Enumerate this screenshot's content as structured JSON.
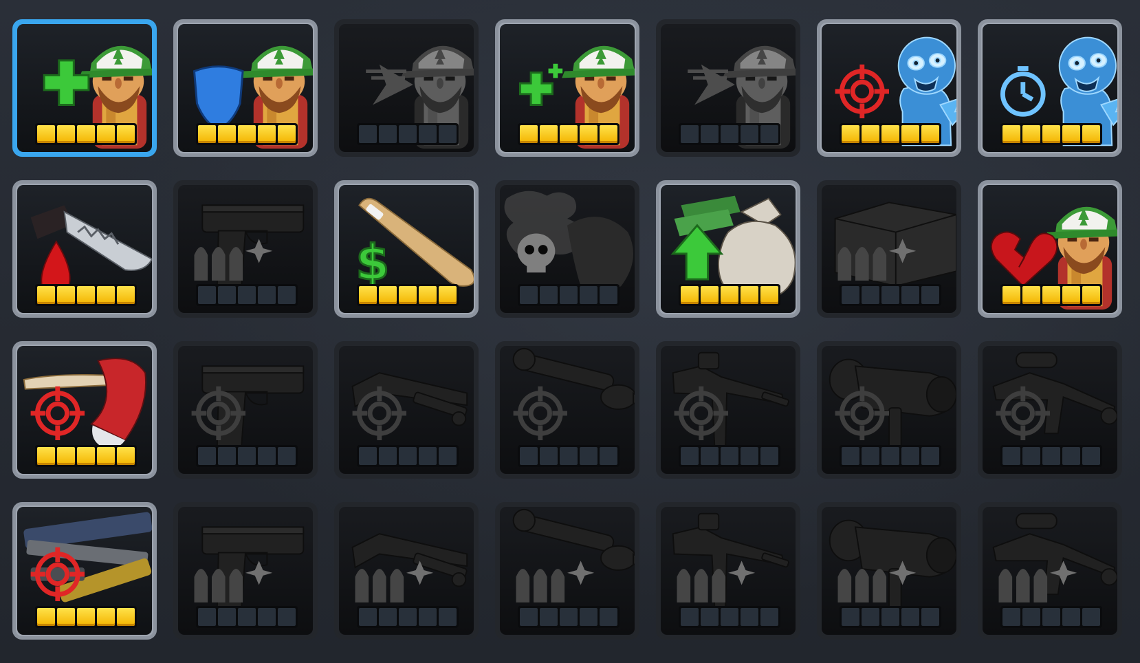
{
  "upgrades": [
    {
      "id": "hero-health",
      "icon": "green-plus-icon",
      "subject": "hero-portrait",
      "level": 5,
      "max": 5,
      "state": "selected"
    },
    {
      "id": "hero-armor",
      "icon": "blue-shield-icon",
      "subject": "hero-portrait",
      "level": 5,
      "max": 5,
      "state": "unlocked"
    },
    {
      "id": "hero-speed",
      "icon": "speed-arrow-icon",
      "subject": "hero-portrait",
      "level": 0,
      "max": 5,
      "state": "locked"
    },
    {
      "id": "hero-regen",
      "icon": "small-green-plus-icon",
      "subject": "hero-portrait",
      "level": 5,
      "max": 5,
      "state": "unlocked"
    },
    {
      "id": "hero-dash",
      "icon": "speed-arrow-icon",
      "subject": "hero-portrait",
      "level": 0,
      "max": 5,
      "state": "locked"
    },
    {
      "id": "zombie-damage",
      "icon": "red-crosshair-icon",
      "subject": "ice-zombie",
      "level": 5,
      "max": 5,
      "state": "unlocked"
    },
    {
      "id": "zombie-freeze-time",
      "icon": "stopwatch-icon",
      "subject": "ice-zombie",
      "level": 5,
      "max": 5,
      "state": "unlocked"
    },
    {
      "id": "knife-bleed",
      "icon": "blood-drop-icon",
      "subject": "knife",
      "level": 5,
      "max": 5,
      "state": "unlocked"
    },
    {
      "id": "pistol-ammo",
      "icon": "bullets-icon",
      "subject": "pistol",
      "level": 0,
      "max": 5,
      "state": "locked"
    },
    {
      "id": "bat-cash",
      "icon": "dollar-icon",
      "subject": "baseball-bat",
      "level": 5,
      "max": 5,
      "state": "unlocked"
    },
    {
      "id": "poison-cloud",
      "icon": "skull-icon",
      "subject": "poison-cloud",
      "level": 0,
      "max": 5,
      "state": "locked"
    },
    {
      "id": "money-bonus",
      "icon": "green-up-arrow-icon",
      "subject": "money-bag",
      "level": 5,
      "max": 5,
      "state": "unlocked"
    },
    {
      "id": "crate-ammo",
      "icon": "bullets-icon",
      "subject": "ammo-crate",
      "level": 0,
      "max": 5,
      "state": "locked"
    },
    {
      "id": "hero-revive",
      "icon": "broken-heart-icon",
      "subject": "hero-portrait",
      "level": 5,
      "max": 5,
      "state": "unlocked"
    },
    {
      "id": "axe-damage",
      "icon": "red-crosshair-icon",
      "subject": "fire-axe",
      "level": 5,
      "max": 5,
      "state": "unlocked"
    },
    {
      "id": "pistol-damage",
      "icon": "crosshair-icon",
      "subject": "pistol",
      "level": 0,
      "max": 5,
      "state": "locked"
    },
    {
      "id": "shotgun-damage",
      "icon": "crosshair-icon",
      "subject": "shotgun",
      "level": 0,
      "max": 5,
      "state": "locked"
    },
    {
      "id": "rpg-damage",
      "icon": "crosshair-icon",
      "subject": "rocket-launcher",
      "level": 0,
      "max": 5,
      "state": "locked"
    },
    {
      "id": "rifle-damage",
      "icon": "crosshair-icon",
      "subject": "assault-rifle",
      "level": 0,
      "max": 5,
      "state": "locked"
    },
    {
      "id": "minigun-damage",
      "icon": "crosshair-icon",
      "subject": "minigun",
      "level": 0,
      "max": 5,
      "state": "locked"
    },
    {
      "id": "sniper-damage",
      "icon": "crosshair-icon",
      "subject": "sniper-rifle",
      "level": 0,
      "max": 5,
      "state": "locked"
    },
    {
      "id": "all-guns-damage",
      "icon": "red-crosshair-icon",
      "subject": "gun-pile",
      "level": 5,
      "max": 5,
      "state": "unlocked"
    },
    {
      "id": "pistol-mag",
      "icon": "bullets-icon",
      "subject": "pistol",
      "level": 0,
      "max": 5,
      "state": "locked"
    },
    {
      "id": "shotgun-mag",
      "icon": "bullets-icon",
      "subject": "shotgun",
      "level": 0,
      "max": 5,
      "state": "locked"
    },
    {
      "id": "rpg-mag",
      "icon": "bullets-icon",
      "subject": "rocket-launcher",
      "level": 0,
      "max": 5,
      "state": "locked"
    },
    {
      "id": "rifle-mag",
      "icon": "bullets-icon",
      "subject": "assault-rifle",
      "level": 0,
      "max": 5,
      "state": "locked"
    },
    {
      "id": "minigun-mag",
      "icon": "bullets-icon",
      "subject": "minigun",
      "level": 0,
      "max": 5,
      "state": "locked"
    },
    {
      "id": "sniper-mag",
      "icon": "bullets-icon",
      "subject": "sniper-rifle",
      "level": 0,
      "max": 5,
      "state": "locked"
    }
  ],
  "colors": {
    "pip_on": "#ffd21f",
    "pip_off": "#2d3540",
    "selected_border": "#3aa6ee",
    "unlocked_border": "#9ea5b0",
    "locked_border": "#23262b"
  }
}
